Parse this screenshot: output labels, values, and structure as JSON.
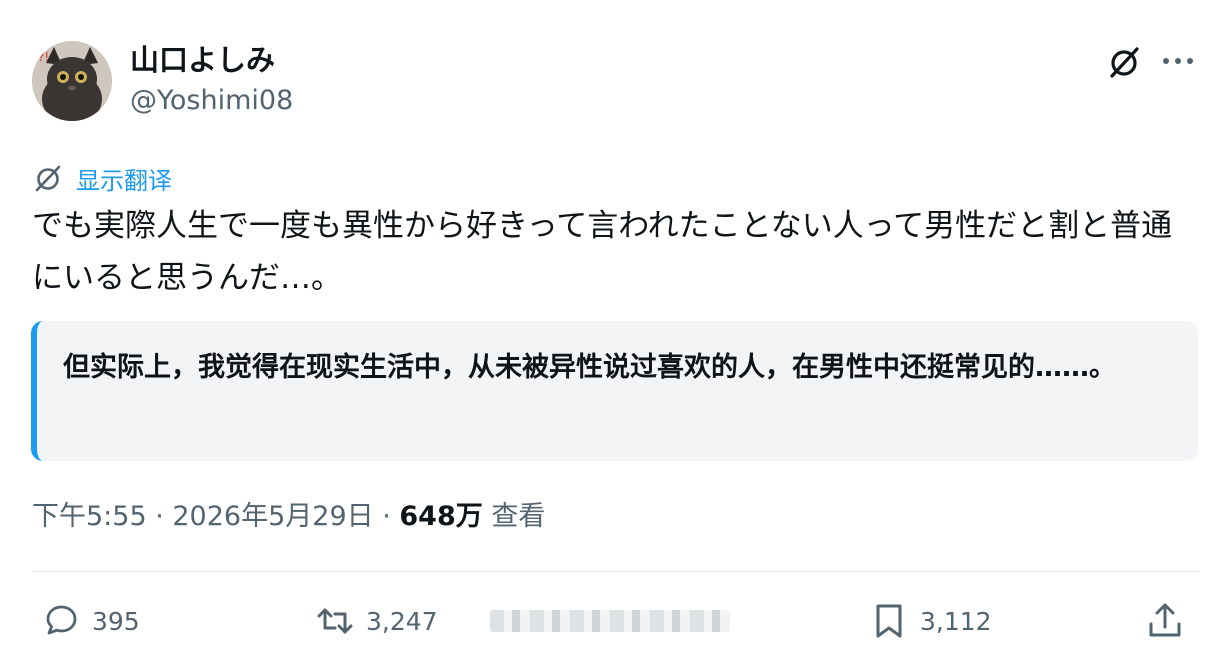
{
  "author": {
    "display_name": "山口よしみ",
    "handle": "@Yoshimi08",
    "avatar_icon": "cat-avatar"
  },
  "header_actions": {
    "grok_icon": "grok-icon",
    "more_icon": "more-icon"
  },
  "translate": {
    "label": "显示翻译",
    "icon": "grok-icon"
  },
  "tweet": {
    "text": "でも実際人生で一度も異性から好きって言われたことない人って男性だと割と普通にいると思うんだ…。"
  },
  "translation": {
    "text": "但实际上，我觉得在现实生活中，从未被异性说过喜欢的人，在男性中还挺常见的……。"
  },
  "meta": {
    "time_date": "下午5:55 · 2026年5月29日 · ",
    "views_count": "648万",
    "views_label": " 查看"
  },
  "actions": {
    "reply_count": "395",
    "retweet_count": "3,247",
    "bookmark_count": "3,112"
  },
  "colors": {
    "accent": "#1d9bf0",
    "muted": "#536471",
    "text": "#0f1419",
    "quote_bg": "#f3f4f6"
  }
}
